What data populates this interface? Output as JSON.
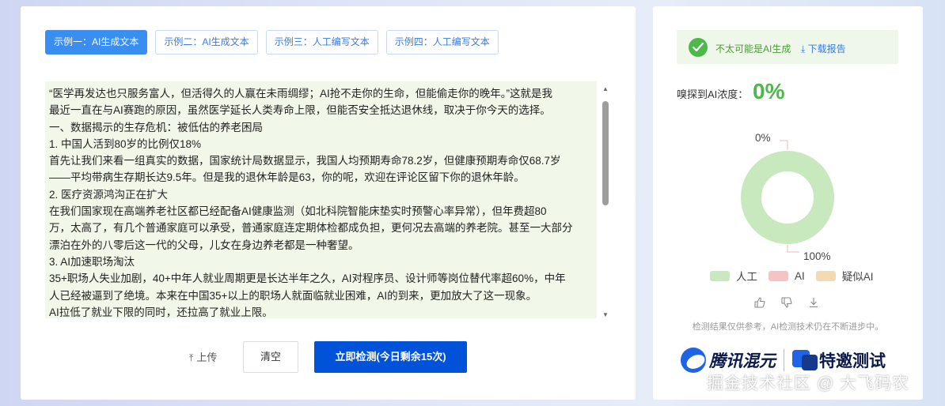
{
  "tabs": [
    {
      "label": "示例一：AI生成文本",
      "active": true
    },
    {
      "label": "示例二：AI生成文本",
      "active": false
    },
    {
      "label": "示例三：人工编写文本",
      "active": false
    },
    {
      "label": "示例四：人工编写文本",
      "active": false
    }
  ],
  "text_lines": [
    "“医学再发达也只服务富人，但活得久的人赢在未雨绸缪；AI抢不走你的生命，但能偷走你的晚年。”这就是我",
    "最近一直在与AI赛跑的原因，虽然医学延长人类寿命上限，但能否安全抵达退休线，取决于你今天的选择。",
    "一、数据揭示的生存危机：被低估的养老困局",
    "1. 中国人活到80岁的比例仅18%",
    "首先让我们来看一组真实的数据，国家统计局数据显示，我国人均预期寿命78.2岁，但健康预期寿命仅68.7岁",
    "——平均带病生存期长达9.5年。但是我的退休年龄是63，你的呢，欢迎在评论区留下你的退休年龄。",
    "2. 医疗资源鸿沟正在扩大",
    "在我们国家现在高端养老社区都已经配备AI健康监测（如北科院智能床垫实时预警心率异常），但年费超80",
    "万，太高了，有几个普通家庭可以承受，普通家庭连定期体检都成负担，更何况去高端的养老院。甚至一大部分",
    "漂泊在外的八零后这一代的父母，儿女在身边养老都是一种奢望。",
    "3. AI加速职场淘汰",
    "35+职场人失业加剧，40+中年人就业周期更是长达半年之久，AI对程序员、设计师等岗位替代率超60%，中年",
    "人已经被逼到了绝境。本来在中国35+以上的职场人就面临就业困难，AI的到来，更加放大了这一现象。",
    "AI拉低了就业下限的同时，还拉高了就业上限。"
  ],
  "actions": {
    "upload_label": "上传",
    "clear_label": "清空",
    "detect_label": "立即检测(今日剩余15次)"
  },
  "result": {
    "verdict": "不太可能是AI生成",
    "download_label": "下载报告",
    "concentration_label": "嗅探到AI浓度：",
    "concentration_value": "0%",
    "disclaimer": "检测结果仅供参考，AI检测技术仍在不断进步中。"
  },
  "chart_data": {
    "type": "pie",
    "variant": "donut",
    "categories": [
      "人工",
      "AI",
      "疑似AI"
    ],
    "values": [
      100,
      0,
      0
    ],
    "colors": [
      "#c8e9bd",
      "#f5c3c3",
      "#f5d9b0"
    ],
    "data_labels": [
      "100%",
      "0%"
    ],
    "legend_position": "bottom"
  },
  "brand": {
    "name": "腾讯混元",
    "invite": "特邀测试"
  },
  "watermark": "掘金技术社区 @ 大飞码农",
  "colors": {
    "accent": "#0052d9",
    "tab_active": "#3a8ef0",
    "success": "#4cb84a",
    "text_bg": "#f1f8ea"
  }
}
